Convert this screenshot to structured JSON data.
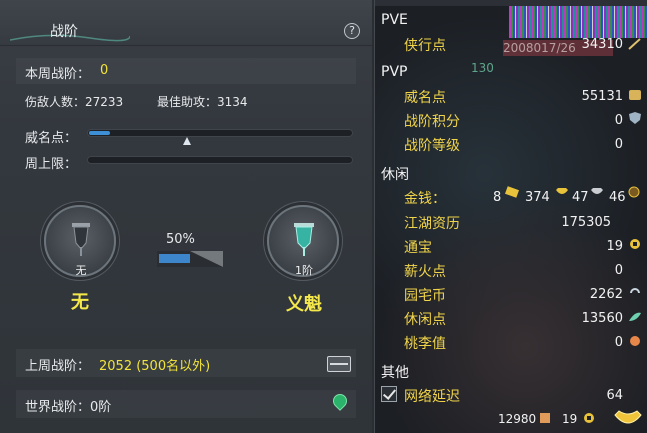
{
  "panel": {
    "title": "战阶",
    "help": "?"
  },
  "weekly": {
    "label": "本周战阶：",
    "value": "0"
  },
  "kills": {
    "text": "伤敌人数：27233"
  },
  "assist": {
    "text": "最佳助攻：3134"
  },
  "prestige": {
    "label": "威名点：",
    "progress": 0.08,
    "marker": 0.38
  },
  "cap": {
    "label": "周上限：",
    "progress": 0.0
  },
  "rank_current": {
    "caption": "无",
    "name": "无"
  },
  "rank_next": {
    "caption": "1阶",
    "name": "义魁"
  },
  "progress": {
    "percent_text": "50%",
    "value": 0.5
  },
  "last_week": {
    "label": "上周战阶：",
    "value": "2052 (500名以外)"
  },
  "world": {
    "text": "世界战阶：0阶"
  },
  "stats": {
    "pve": {
      "title": "PVE",
      "xia_label": "侠行点",
      "xia_value": "34310"
    },
    "pvp": {
      "title": "PVP",
      "rows": [
        {
          "label": "威名点",
          "value": "55131"
        },
        {
          "label": "战阶积分",
          "value": "0"
        },
        {
          "label": "战阶等级",
          "value": "0"
        }
      ]
    },
    "leisure": {
      "title": "休闲",
      "money_label": "金钱：",
      "money_gold": "8",
      "money_silver": "374",
      "money_copper1": "47",
      "money_copper2": "46",
      "rows": [
        {
          "label": "江湖资历",
          "value": "175305"
        },
        {
          "label": "通宝",
          "value": "19"
        },
        {
          "label": "薪火点",
          "value": "0"
        },
        {
          "label": "园宅币",
          "value": "2262"
        },
        {
          "label": "休闲点",
          "value": "13560"
        },
        {
          "label": "桃李值",
          "value": "0"
        }
      ]
    },
    "other": {
      "title": "其他",
      "latency_label": "网络延迟",
      "latency_value": "64",
      "latency_checked": true
    },
    "footer": {
      "val1": "12980",
      "val2": "19"
    },
    "overlay": {
      "text": "2008017/26",
      "num": "130"
    }
  },
  "colors": {
    "accent_yellow": "#f2e43a",
    "bar_blue": "#3d8fd6",
    "label_gold": "#f0d44a"
  }
}
